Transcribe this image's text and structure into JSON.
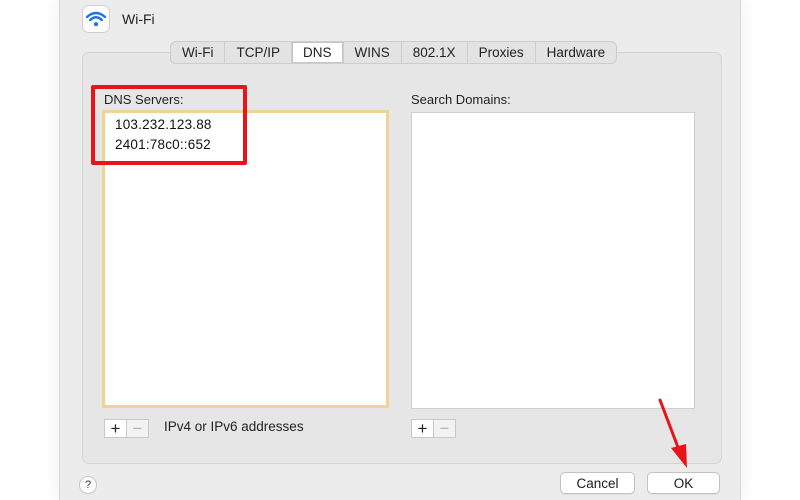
{
  "window": {
    "title": "Wi-Fi",
    "icon": "wifi-icon"
  },
  "tabs": [
    "Wi-Fi",
    "TCP/IP",
    "DNS",
    "WINS",
    "802.1X",
    "Proxies",
    "Hardware"
  ],
  "active_tab": "DNS",
  "dns": {
    "label": "DNS Servers:",
    "entries": [
      "103.232.123.88",
      "2401:78c0::652"
    ],
    "add_label": "+",
    "remove_label": "−",
    "hint": "IPv4 or IPv6 addresses"
  },
  "search": {
    "label": "Search Domains:",
    "add_label": "+",
    "remove_label": "−"
  },
  "footer": {
    "help_label": "?",
    "cancel_label": "Cancel",
    "ok_label": "OK"
  },
  "colors": {
    "highlight": "#e8141a",
    "dns_box_border": "#f1d396",
    "wifi_blue": "#1a73e8"
  }
}
